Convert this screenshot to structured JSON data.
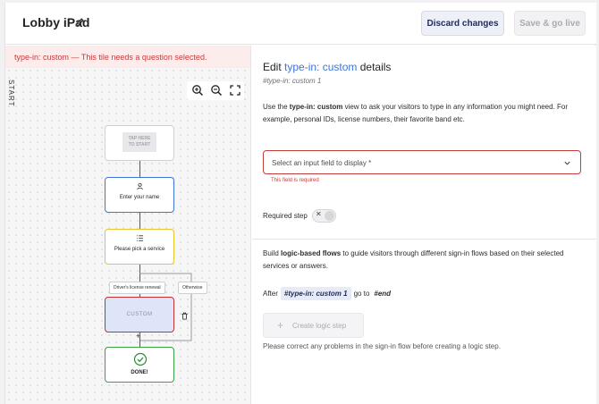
{
  "header": {
    "title": "Lobby iPad",
    "discard_label": "Discard changes",
    "save_label": "Save & go live"
  },
  "canvas": {
    "error_banner": "type-in: custom — This tile needs a question selected.",
    "start_label": "START",
    "nodes": {
      "tap_line1": "TAP HERE",
      "tap_line2": "TO START",
      "name": "Enter your name",
      "service": "Please pick a service",
      "custom": "CUSTOM",
      "done": "DONE!"
    },
    "branches": {
      "left": "Driver's license renewal",
      "right": "Otherwise"
    }
  },
  "panel": {
    "title_prefix": "Edit ",
    "title_highlight": "type-in: custom",
    "title_suffix": " details",
    "subtitle": "#type-in: custom 1",
    "desc_pre": "Use the ",
    "desc_bold": "type-in: custom",
    "desc_post": " view to ask your visitors to type in any information you might need. For example, personal IDs, license numbers, their favorite band etc.",
    "select_placeholder": "Select an input field to display *",
    "select_error": "This field is required",
    "required_label": "Required step",
    "logic_pre": "Build ",
    "logic_bold": "logic-based flows",
    "logic_post": " to guide visitors through different sign-in flows based on their selected services or answers.",
    "after_label": "After",
    "after_chip": "#type-in: custom 1",
    "goto_label": "go to",
    "goto_target": "#end",
    "create_logic_label": "Create logic step",
    "logic_note": "Please correct any problems in the sign-in flow before creating a logic step."
  },
  "colors": {
    "accent_blue": "#3f75d6",
    "error_red": "#c23c3c",
    "service_yellow": "#e9c233",
    "done_green": "#3aa345"
  },
  "icons": [
    "pencil-icon",
    "zoom-in-icon",
    "zoom-out-icon",
    "fullscreen-icon",
    "person-icon",
    "list-icon",
    "trash-icon",
    "check-circle-icon",
    "chevron-down-icon",
    "plus-icon",
    "close-icon"
  ]
}
